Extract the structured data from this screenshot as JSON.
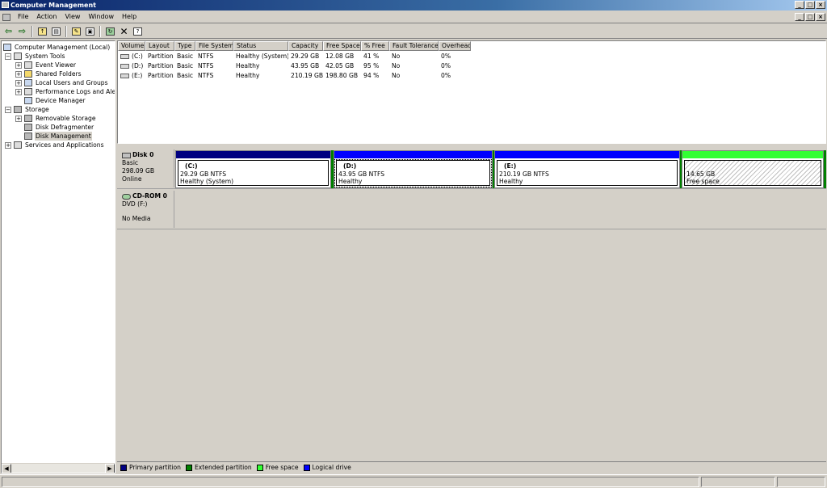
{
  "window": {
    "title": "Computer Management"
  },
  "menu": [
    "File",
    "Action",
    "View",
    "Window",
    "Help"
  ],
  "toolbar_icons": [
    "back-arrow-icon",
    "forward-arrow-icon",
    "up-folder-icon",
    "show-tree-icon",
    "properties-icon",
    "console-icon",
    "refresh-icon",
    "delete-icon",
    "help-icon"
  ],
  "tree": {
    "root": "Computer Management (Local)",
    "system_tools": "System Tools",
    "event_viewer": "Event Viewer",
    "shared_folders": "Shared Folders",
    "local_users": "Local Users and Groups",
    "perf_logs": "Performance Logs and Alerts",
    "device_manager": "Device Manager",
    "storage": "Storage",
    "removable_storage": "Removable Storage",
    "disk_defragmenter": "Disk Defragmenter",
    "disk_management": "Disk Management",
    "services": "Services and Applications"
  },
  "volumes": {
    "columns": [
      "Volume",
      "Layout",
      "Type",
      "File System",
      "Status",
      "Capacity",
      "Free Space",
      "% Free",
      "Fault Tolerance",
      "Overhead"
    ],
    "rows": [
      [
        "(C:)",
        "Partition",
        "Basic",
        "NTFS",
        "Healthy (System)",
        "29.29 GB",
        "12.08 GB",
        "41 %",
        "No",
        "0%"
      ],
      [
        "(D:)",
        "Partition",
        "Basic",
        "NTFS",
        "Healthy",
        "43.95 GB",
        "42.05 GB",
        "95 %",
        "No",
        "0%"
      ],
      [
        "(E:)",
        "Partition",
        "Basic",
        "NTFS",
        "Healthy",
        "210.19 GB",
        "198.80 GB",
        "94 %",
        "No",
        "0%"
      ]
    ]
  },
  "disk0": {
    "name": "Disk 0",
    "type": "Basic",
    "size": "298.09 GB",
    "status": "Online",
    "partitions": [
      {
        "name": "(C:)",
        "detail": "29.29 GB NTFS",
        "status": "Healthy (System)",
        "kind": "primary"
      },
      {
        "name": "(D:)",
        "detail": "43.95 GB NTFS",
        "status": "Healthy",
        "kind": "logical"
      },
      {
        "name": "(E:)",
        "detail": "210.19 GB NTFS",
        "status": "Healthy",
        "kind": "logical"
      },
      {
        "name": "",
        "detail": "14.65 GB",
        "status": "Free space",
        "kind": "free"
      }
    ]
  },
  "cdrom0": {
    "name": "CD-ROM 0",
    "type": "DVD (F:)",
    "status": "No Media"
  },
  "legend": [
    {
      "label": "Primary partition",
      "color": "#000080"
    },
    {
      "label": "Extended partition",
      "color": "#008000"
    },
    {
      "label": "Free space",
      "color": "#33ff33"
    },
    {
      "label": "Logical drive",
      "color": "#0000ff"
    }
  ],
  "colors": {
    "primary": "#000080",
    "extended": "#008000",
    "free": "#33ff33",
    "logical": "#0000ff"
  }
}
